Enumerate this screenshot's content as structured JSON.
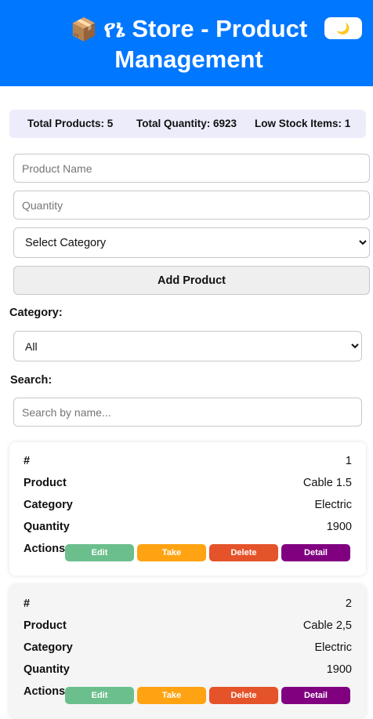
{
  "header": {
    "icon": "package-box-icon",
    "title_line1": "የኔ Store - Product",
    "title_line2": "Management",
    "theme_toggle_icon": "🌙"
  },
  "stats": {
    "total_products": "Total Products: 5",
    "total_quantity": "Total Quantity: 6923",
    "low_stock": "Low Stock Items: 1"
  },
  "form": {
    "name_placeholder": "Product Name",
    "quantity_placeholder": "Quantity",
    "category_select": "Select Category",
    "add_button": "Add Product"
  },
  "filter": {
    "category_label": "Category:",
    "category_value": "All",
    "search_label": "Search:",
    "search_placeholder": "Search by name..."
  },
  "labels": {
    "num": "#",
    "product": "Product",
    "category": "Category",
    "quantity": "Quantity",
    "actions": "Actions",
    "edit": "Edit",
    "take": "Take",
    "delete": "Delete",
    "detail": "Detail"
  },
  "products": [
    {
      "num": "1",
      "product": "Cable 1.5",
      "category": "Electric",
      "quantity": "1900"
    },
    {
      "num": "2",
      "product": "Cable 2,5",
      "category": "Electric",
      "quantity": "1900"
    }
  ],
  "colors": {
    "header": "#0077ff",
    "edit": "#6bbf8c",
    "take": "#ffa312",
    "delete": "#e5532a",
    "detail": "#800080"
  }
}
